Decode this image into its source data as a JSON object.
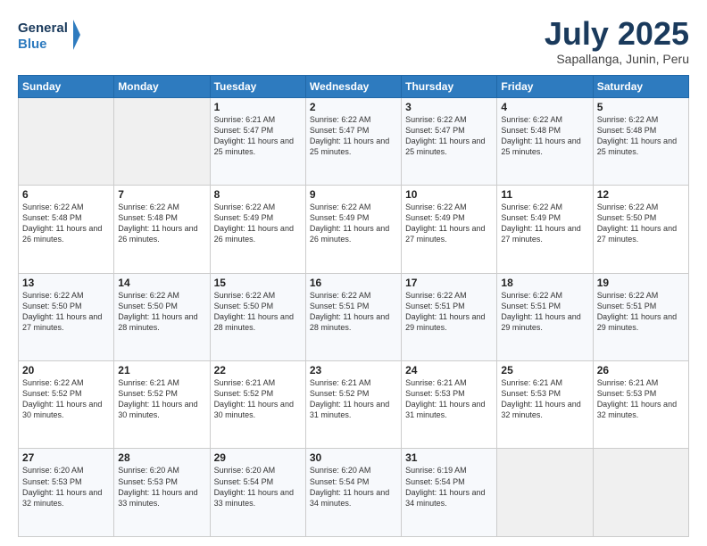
{
  "header": {
    "logo_line1": "General",
    "logo_line2": "Blue",
    "month": "July 2025",
    "location": "Sapallanga, Junin, Peru"
  },
  "weekdays": [
    "Sunday",
    "Monday",
    "Tuesday",
    "Wednesday",
    "Thursday",
    "Friday",
    "Saturday"
  ],
  "weeks": [
    [
      {
        "day": "",
        "info": ""
      },
      {
        "day": "",
        "info": ""
      },
      {
        "day": "1",
        "info": "Sunrise: 6:21 AM\nSunset: 5:47 PM\nDaylight: 11 hours and 25 minutes."
      },
      {
        "day": "2",
        "info": "Sunrise: 6:22 AM\nSunset: 5:47 PM\nDaylight: 11 hours and 25 minutes."
      },
      {
        "day": "3",
        "info": "Sunrise: 6:22 AM\nSunset: 5:47 PM\nDaylight: 11 hours and 25 minutes."
      },
      {
        "day": "4",
        "info": "Sunrise: 6:22 AM\nSunset: 5:48 PM\nDaylight: 11 hours and 25 minutes."
      },
      {
        "day": "5",
        "info": "Sunrise: 6:22 AM\nSunset: 5:48 PM\nDaylight: 11 hours and 25 minutes."
      }
    ],
    [
      {
        "day": "6",
        "info": "Sunrise: 6:22 AM\nSunset: 5:48 PM\nDaylight: 11 hours and 26 minutes."
      },
      {
        "day": "7",
        "info": "Sunrise: 6:22 AM\nSunset: 5:48 PM\nDaylight: 11 hours and 26 minutes."
      },
      {
        "day": "8",
        "info": "Sunrise: 6:22 AM\nSunset: 5:49 PM\nDaylight: 11 hours and 26 minutes."
      },
      {
        "day": "9",
        "info": "Sunrise: 6:22 AM\nSunset: 5:49 PM\nDaylight: 11 hours and 26 minutes."
      },
      {
        "day": "10",
        "info": "Sunrise: 6:22 AM\nSunset: 5:49 PM\nDaylight: 11 hours and 27 minutes."
      },
      {
        "day": "11",
        "info": "Sunrise: 6:22 AM\nSunset: 5:49 PM\nDaylight: 11 hours and 27 minutes."
      },
      {
        "day": "12",
        "info": "Sunrise: 6:22 AM\nSunset: 5:50 PM\nDaylight: 11 hours and 27 minutes."
      }
    ],
    [
      {
        "day": "13",
        "info": "Sunrise: 6:22 AM\nSunset: 5:50 PM\nDaylight: 11 hours and 27 minutes."
      },
      {
        "day": "14",
        "info": "Sunrise: 6:22 AM\nSunset: 5:50 PM\nDaylight: 11 hours and 28 minutes."
      },
      {
        "day": "15",
        "info": "Sunrise: 6:22 AM\nSunset: 5:50 PM\nDaylight: 11 hours and 28 minutes."
      },
      {
        "day": "16",
        "info": "Sunrise: 6:22 AM\nSunset: 5:51 PM\nDaylight: 11 hours and 28 minutes."
      },
      {
        "day": "17",
        "info": "Sunrise: 6:22 AM\nSunset: 5:51 PM\nDaylight: 11 hours and 29 minutes."
      },
      {
        "day": "18",
        "info": "Sunrise: 6:22 AM\nSunset: 5:51 PM\nDaylight: 11 hours and 29 minutes."
      },
      {
        "day": "19",
        "info": "Sunrise: 6:22 AM\nSunset: 5:51 PM\nDaylight: 11 hours and 29 minutes."
      }
    ],
    [
      {
        "day": "20",
        "info": "Sunrise: 6:22 AM\nSunset: 5:52 PM\nDaylight: 11 hours and 30 minutes."
      },
      {
        "day": "21",
        "info": "Sunrise: 6:21 AM\nSunset: 5:52 PM\nDaylight: 11 hours and 30 minutes."
      },
      {
        "day": "22",
        "info": "Sunrise: 6:21 AM\nSunset: 5:52 PM\nDaylight: 11 hours and 30 minutes."
      },
      {
        "day": "23",
        "info": "Sunrise: 6:21 AM\nSunset: 5:52 PM\nDaylight: 11 hours and 31 minutes."
      },
      {
        "day": "24",
        "info": "Sunrise: 6:21 AM\nSunset: 5:53 PM\nDaylight: 11 hours and 31 minutes."
      },
      {
        "day": "25",
        "info": "Sunrise: 6:21 AM\nSunset: 5:53 PM\nDaylight: 11 hours and 32 minutes."
      },
      {
        "day": "26",
        "info": "Sunrise: 6:21 AM\nSunset: 5:53 PM\nDaylight: 11 hours and 32 minutes."
      }
    ],
    [
      {
        "day": "27",
        "info": "Sunrise: 6:20 AM\nSunset: 5:53 PM\nDaylight: 11 hours and 32 minutes."
      },
      {
        "day": "28",
        "info": "Sunrise: 6:20 AM\nSunset: 5:53 PM\nDaylight: 11 hours and 33 minutes."
      },
      {
        "day": "29",
        "info": "Sunrise: 6:20 AM\nSunset: 5:54 PM\nDaylight: 11 hours and 33 minutes."
      },
      {
        "day": "30",
        "info": "Sunrise: 6:20 AM\nSunset: 5:54 PM\nDaylight: 11 hours and 34 minutes."
      },
      {
        "day": "31",
        "info": "Sunrise: 6:19 AM\nSunset: 5:54 PM\nDaylight: 11 hours and 34 minutes."
      },
      {
        "day": "",
        "info": ""
      },
      {
        "day": "",
        "info": ""
      }
    ]
  ]
}
